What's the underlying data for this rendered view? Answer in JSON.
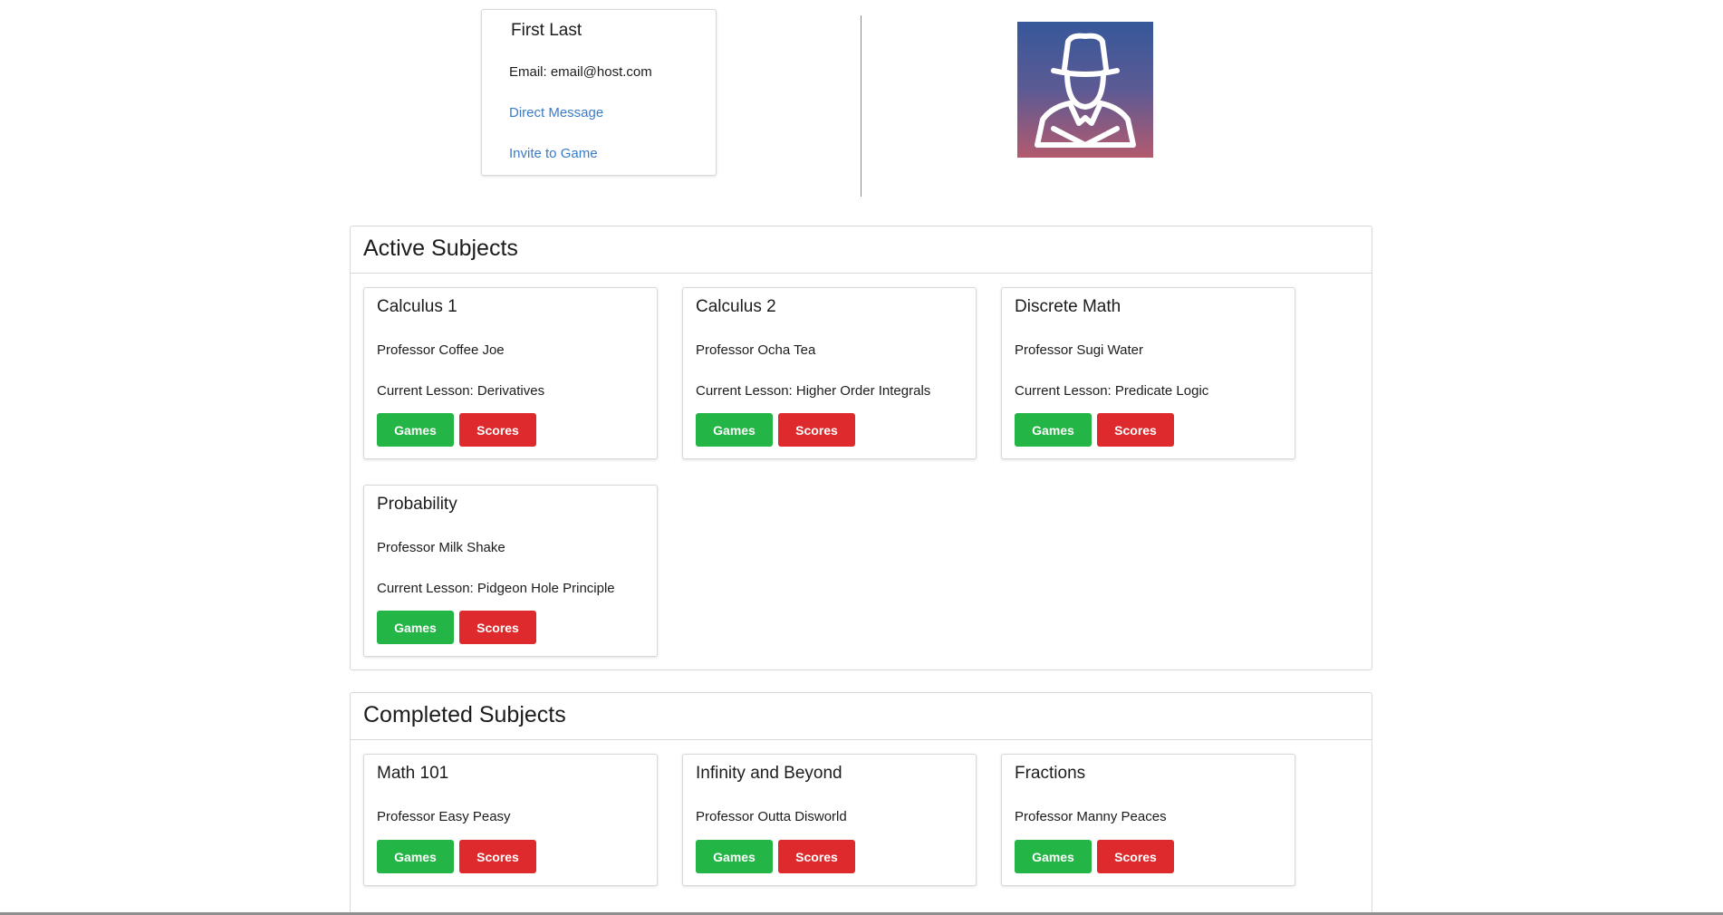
{
  "profile": {
    "name": "First Last",
    "email": "Email: email@host.com",
    "direct_message": "Direct Message",
    "invite_to_game": "Invite to Game"
  },
  "avatar": {
    "icon": "detective-avatar-icon",
    "colors": [
      "#36589a",
      "#5c5a94",
      "#b35a6e"
    ]
  },
  "colors": {
    "games_button": "#23b545",
    "scores_button": "#de2a2c",
    "link": "#3a7bc8"
  },
  "active": {
    "title": "Active Subjects",
    "subjects": [
      {
        "name": "Calculus 1",
        "professor": "Professor Coffee Joe",
        "lesson": "Current Lesson: Derivatives",
        "games": "Games",
        "scores": "Scores"
      },
      {
        "name": "Calculus 2",
        "professor": "Professor Ocha Tea",
        "lesson": "Current Lesson: Higher Order Integrals",
        "games": "Games",
        "scores": "Scores"
      },
      {
        "name": "Discrete Math",
        "professor": "Professor Sugi Water",
        "lesson": "Current Lesson: Predicate Logic",
        "games": "Games",
        "scores": "Scores"
      },
      {
        "name": "Probability",
        "professor": "Professor Milk Shake",
        "lesson": "Current Lesson: Pidgeon Hole Principle",
        "games": "Games",
        "scores": "Scores"
      }
    ]
  },
  "completed": {
    "title": "Completed Subjects",
    "subjects": [
      {
        "name": "Math 101",
        "professor": "Professor Easy Peasy",
        "games": "Games",
        "scores": "Scores"
      },
      {
        "name": "Infinity and Beyond",
        "professor": "Professor Outta Disworld",
        "games": "Games",
        "scores": "Scores"
      },
      {
        "name": "Fractions",
        "professor": "Professor Manny Peaces",
        "games": "Games",
        "scores": "Scores"
      }
    ]
  }
}
